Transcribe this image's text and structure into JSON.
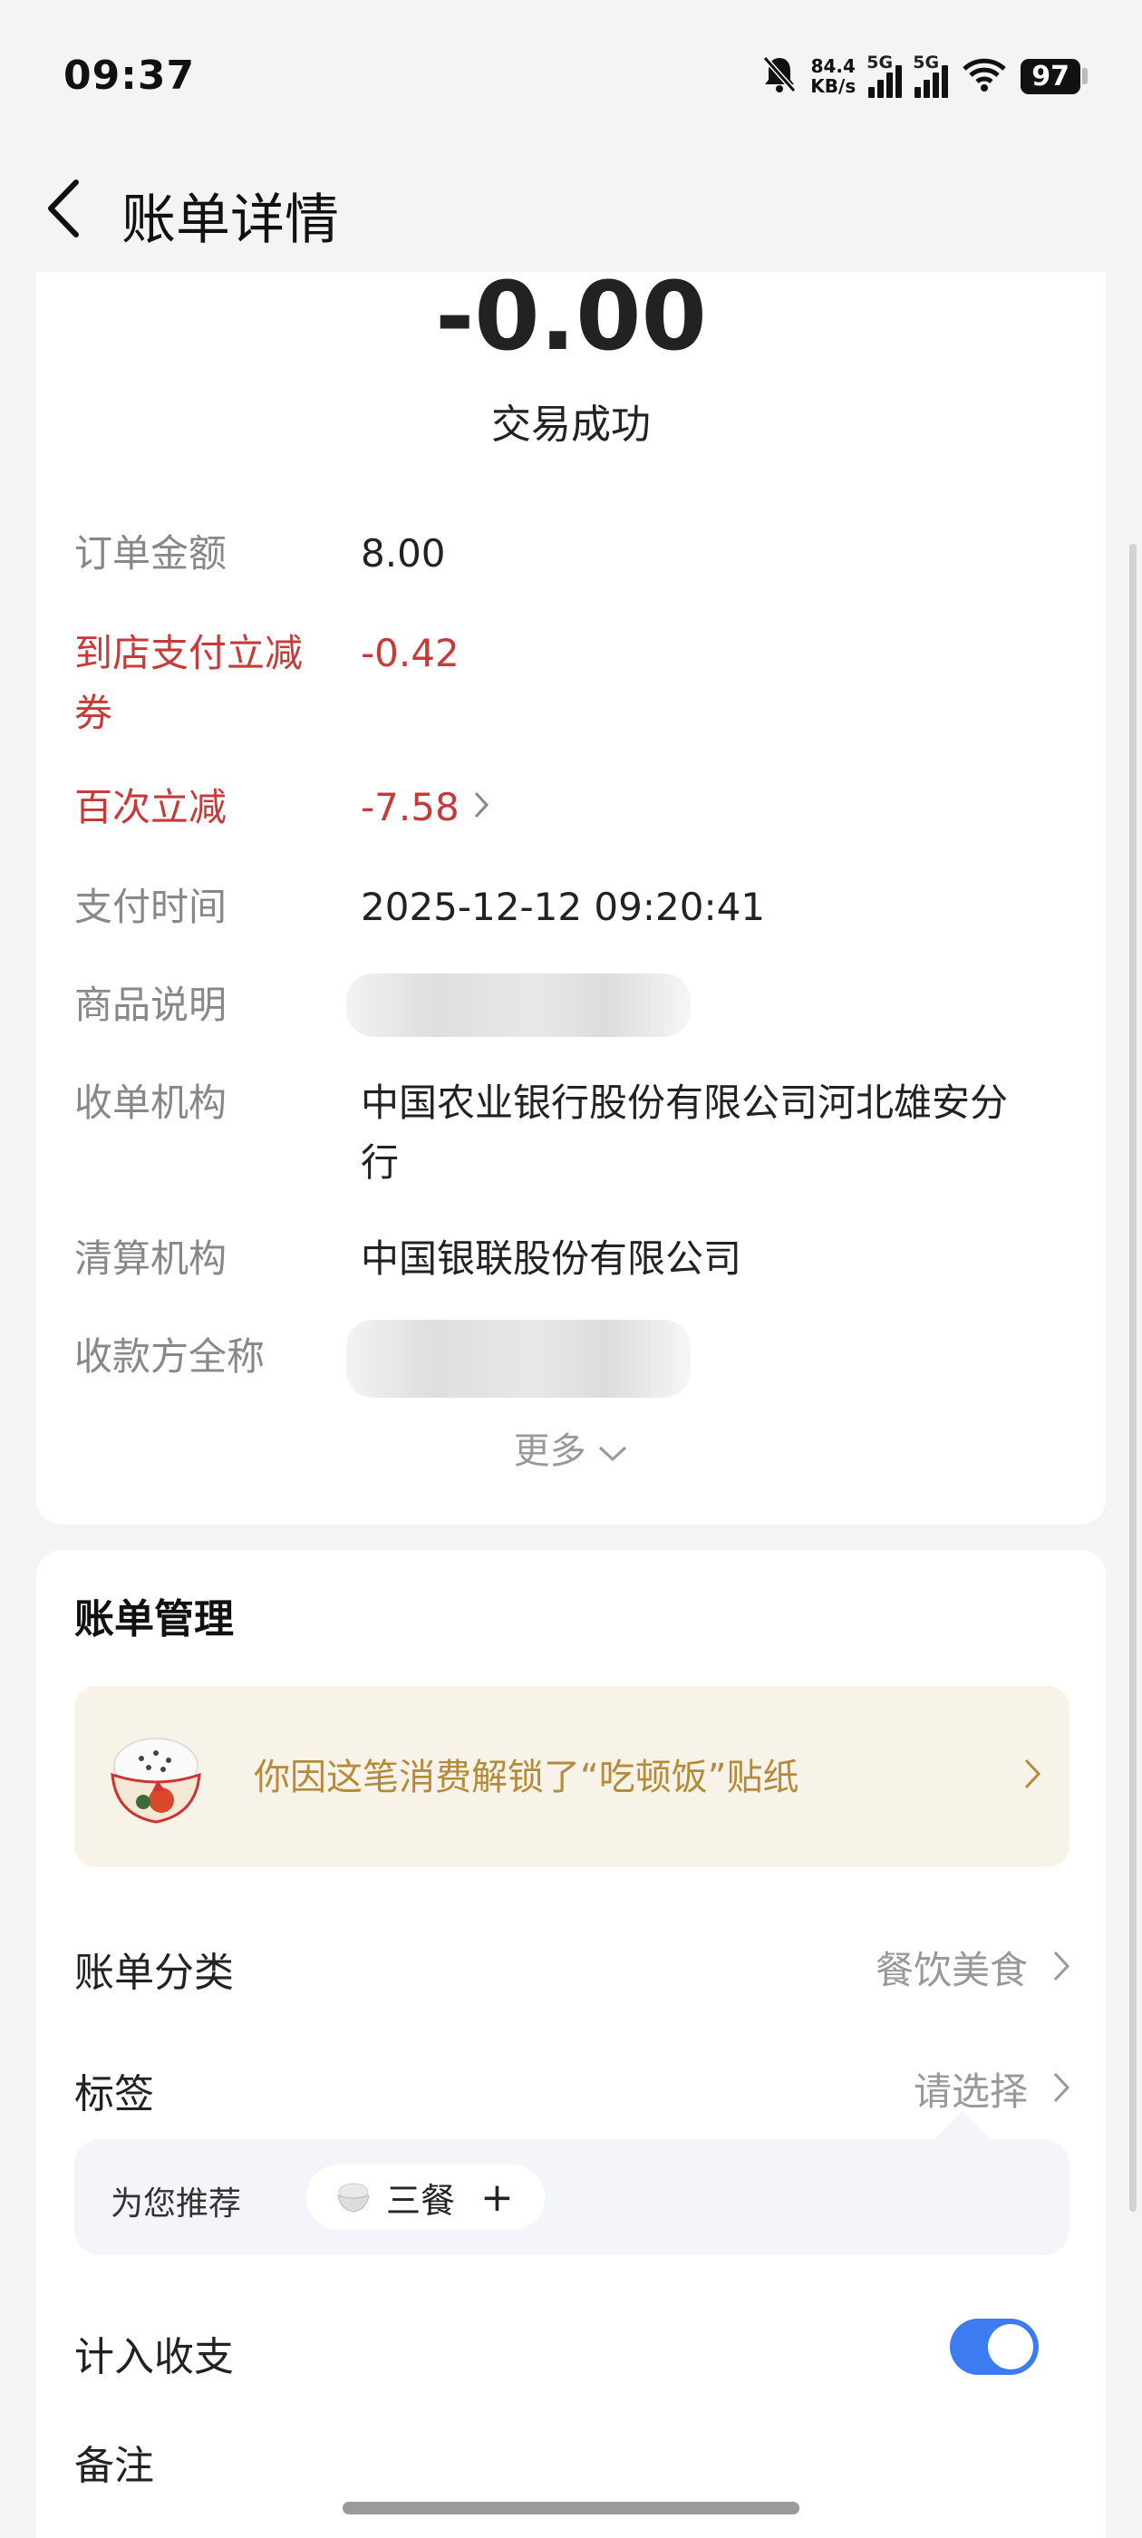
{
  "status_bar": {
    "time": "09:37",
    "net_speed_value": "84.4",
    "net_speed_unit": "KB/s",
    "signal1_label": "5G",
    "signal2_label": "5G",
    "battery": "97"
  },
  "header": {
    "title": "账单详情"
  },
  "summary": {
    "amount": "-0.00",
    "status": "交易成功"
  },
  "details": [
    {
      "label": "订单金额",
      "value": "8.00"
    },
    {
      "label_line1": "到店支付立减",
      "label_line2": "券",
      "value": "-0.42"
    },
    {
      "label": "百次立减",
      "value": "-7.58"
    },
    {
      "label": "支付时间",
      "value": "2025-12-12 09:20:41"
    },
    {
      "label": "商品说明",
      "value": ""
    },
    {
      "label": "收单机构",
      "value_line1": "中国农业银行股份有限公司河北雄安分",
      "value_line2": "行"
    },
    {
      "label": "清算机构",
      "value": "中国银联股份有限公司"
    },
    {
      "label": "收款方全称",
      "value": ""
    }
  ],
  "more_label": "更多",
  "management": {
    "title": "账单管理",
    "sticker_text": "你因这笔消费解锁了“吃顿饭”贴纸",
    "category_label": "账单分类",
    "category_value": "餐饮美食",
    "tag_label": "标签",
    "tag_value": "请选择",
    "recommend_label": "为您推荐",
    "recommend_chip": "三餐",
    "recommend_plus": "+",
    "include_label": "计入收支",
    "include_enabled": true,
    "note_label": "备注"
  },
  "colors": {
    "accent_blue": "#3d7bf0",
    "discount_red": "#c73a3a",
    "sticker_gold": "#b48b3a"
  }
}
